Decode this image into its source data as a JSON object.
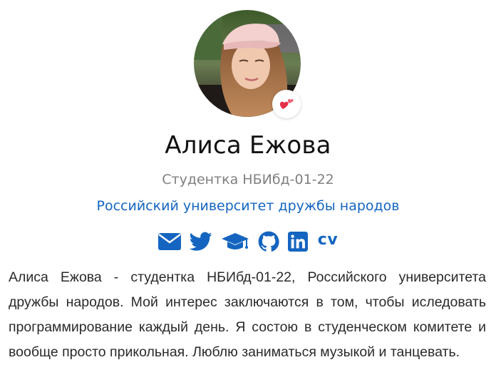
{
  "profile": {
    "name": "Алиса Ежова",
    "position": "Студентка НБИбд-01-22",
    "university": "Российский университет дружбы народов",
    "badge_emoji": "💕"
  },
  "socials": [
    {
      "icon": "envelope-icon"
    },
    {
      "icon": "twitter-icon"
    },
    {
      "icon": "graduation-cap-icon"
    },
    {
      "icon": "github-icon"
    },
    {
      "icon": "linkedin-icon"
    },
    {
      "icon": "cv-icon",
      "label": "cv"
    }
  ],
  "bio": {
    "text": "Алиса Ежова - студентка НБИбд-01-22, Российского университета дружбы народов. Мой интерес заключаются в том, чтобы иследовать программирование каждый день. Я состою в студенческом комитете и вообще просто прикольная. Люблю заниматься музыкой и танцевать."
  },
  "colors": {
    "accent": "#1565c0",
    "muted": "#808080",
    "text": "#2a2a2a"
  }
}
